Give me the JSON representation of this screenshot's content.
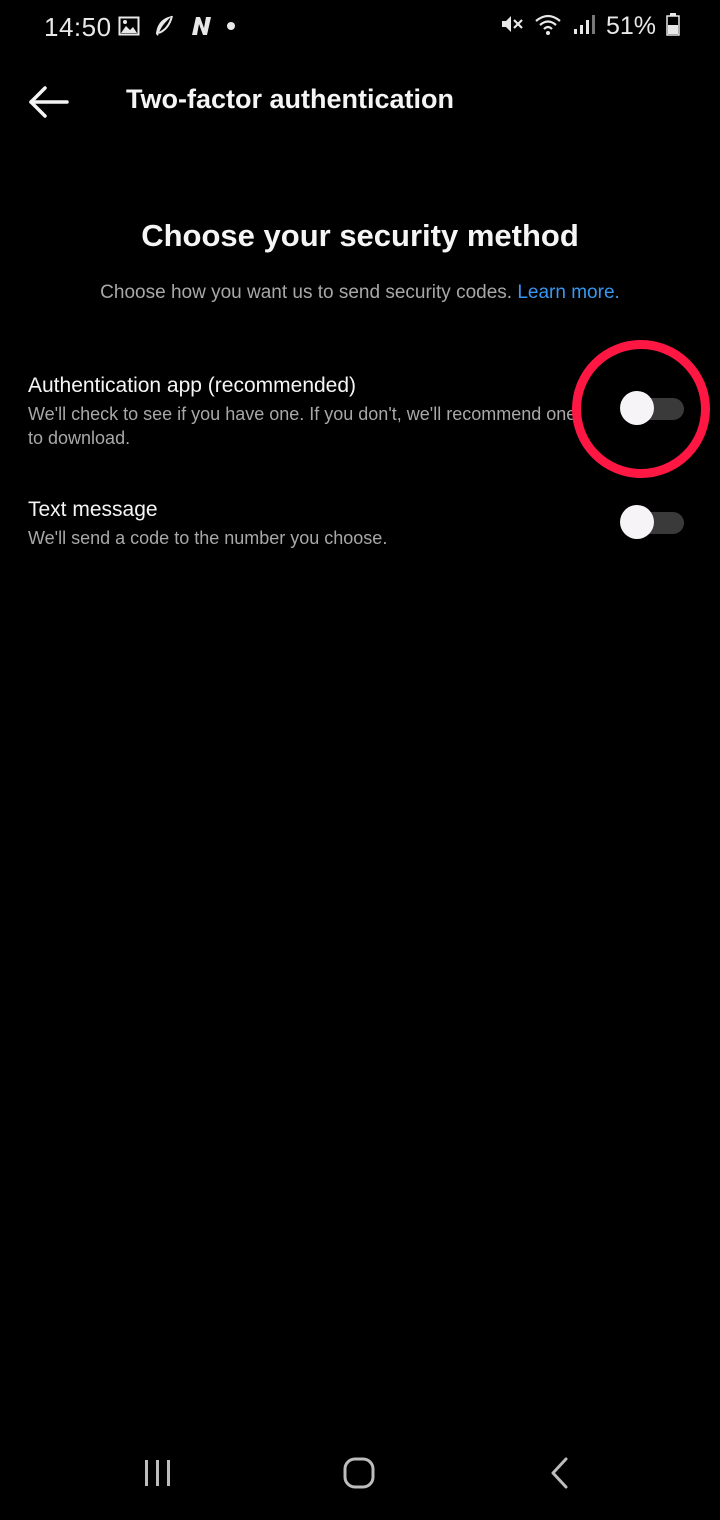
{
  "status_bar": {
    "time": "14:50",
    "battery": "51%",
    "icons": [
      "gallery-icon",
      "feather-icon",
      "n-app-icon",
      "dot-icon",
      "mute-icon",
      "wifi-icon",
      "signal-icon",
      "battery-icon"
    ]
  },
  "app_bar": {
    "title": "Two-factor authentication",
    "back_icon": "arrow-left-icon"
  },
  "main": {
    "heading": "Choose your security method",
    "subheading": "Choose how you want us to send security codes.",
    "learn_more": "Learn more."
  },
  "options": [
    {
      "title": "Authentication app (recommended)",
      "description": "We'll check to see if you have one. If you don't, we'll recommend one to download.",
      "enabled": false
    },
    {
      "title": "Text message",
      "description": "We'll send a code to the number you choose.",
      "enabled": false
    }
  ],
  "colors": {
    "background": "#000000",
    "link": "#3897f0",
    "highlight": "#ff1744",
    "toggle_track": "#3a3a3a",
    "toggle_knob": "#f7f4f8"
  },
  "nav_bar": {
    "icons": [
      "recent-apps-icon",
      "home-icon",
      "back-nav-icon"
    ]
  }
}
